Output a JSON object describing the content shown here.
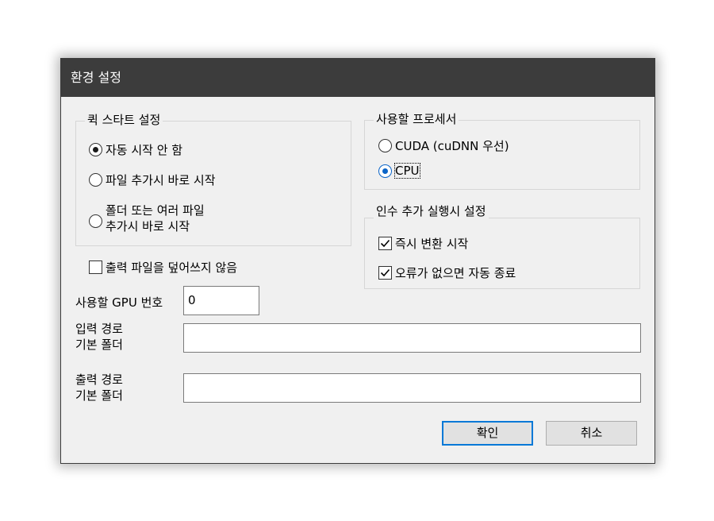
{
  "window": {
    "title": "환경 설정"
  },
  "quickstart": {
    "title": "퀵 스타트 설정",
    "options": [
      "자동 시작 안 함",
      "파일 추가시 바로 시작",
      "폴더 또는 여러 파일",
      "추가시 바로 시작"
    ],
    "selected_index": 0
  },
  "no_overwrite": {
    "label": "출력 파일을 덮어쓰지 않음",
    "checked": false
  },
  "processor": {
    "title": "사용할 프로세서",
    "options": [
      "CUDA (cuDNN 우선)",
      "CPU"
    ],
    "selected": "CPU"
  },
  "post_args": {
    "title": "인수 추가 실행시 설정",
    "items": [
      {
        "label": "즉시 변환 시작",
        "checked": true
      },
      {
        "label": "오류가 없으면 자동 종료",
        "checked": true
      }
    ]
  },
  "gpu": {
    "label": "사용할 GPU 번호",
    "value": "0"
  },
  "input_folder": {
    "label_line1": "입력 경로",
    "label_line2": "기본 폴더",
    "value": ""
  },
  "output_folder": {
    "label_line1": "출력 경로",
    "label_line2": "기본 폴더",
    "value": ""
  },
  "buttons": {
    "ok": "확인",
    "cancel": "취소"
  },
  "colors": {
    "titlebar": "#3c3c3c",
    "dialog_bg": "#f0f0f0",
    "accent": "#0078d7",
    "radio_selected": "#0a64c8"
  }
}
